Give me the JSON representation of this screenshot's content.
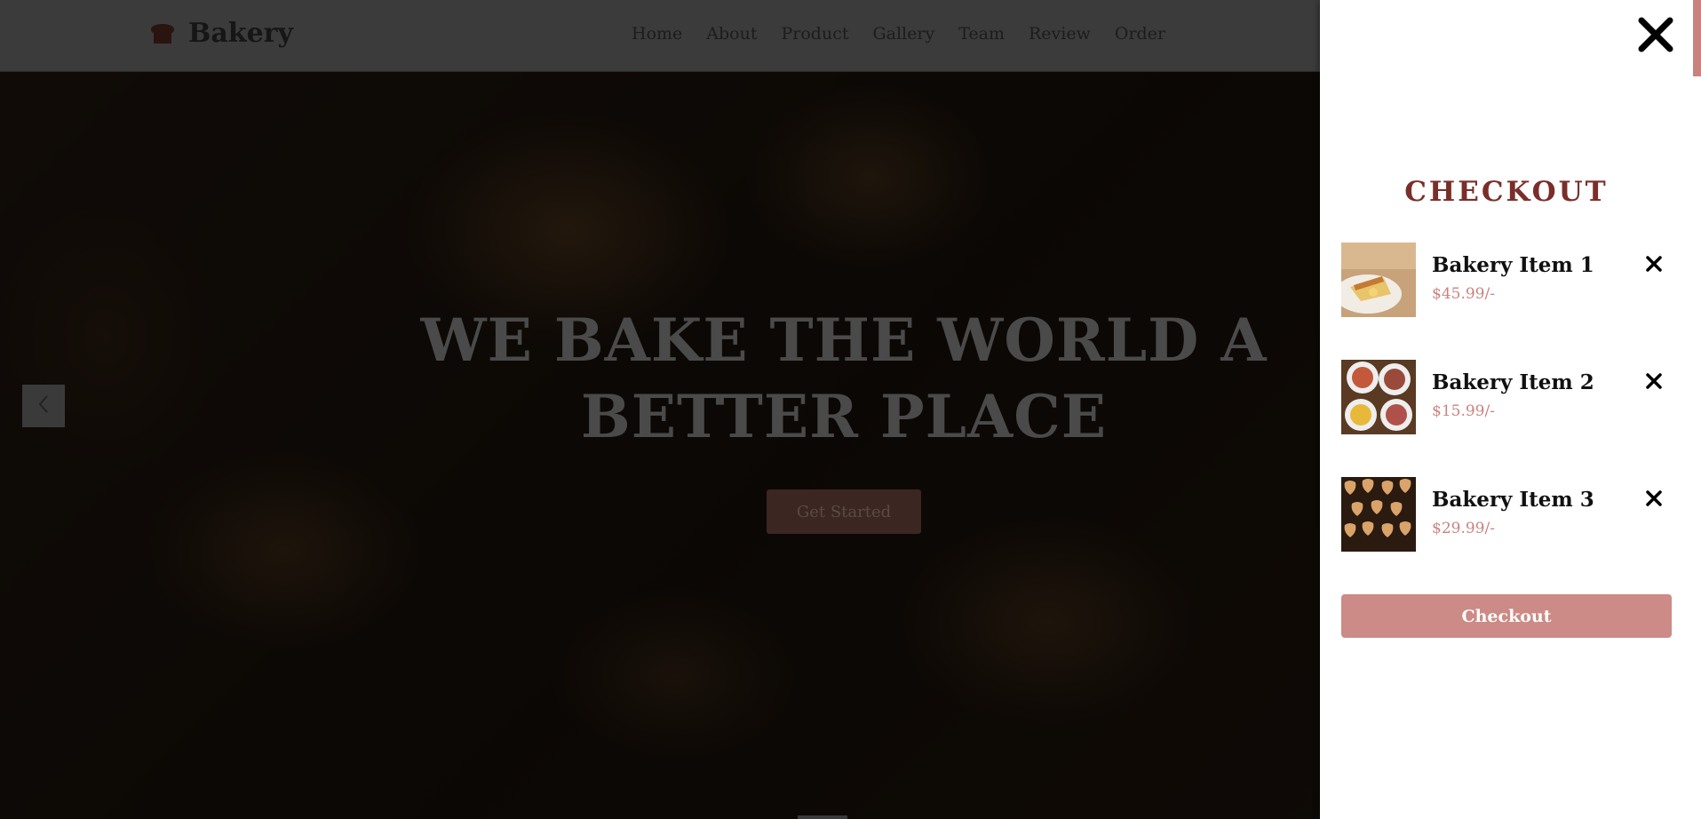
{
  "brand": {
    "name": "Bakery",
    "logo_icon": "bread-icon"
  },
  "nav": {
    "links": [
      "Home",
      "About",
      "Product",
      "Gallery",
      "Team",
      "Review",
      "Order"
    ]
  },
  "hero": {
    "title": "WE BAKE THE WORLD A BETTER PLACE",
    "cta_label": "Get Started",
    "prev_icon": "chevron-left-icon"
  },
  "checkout": {
    "close_icon": "close-icon",
    "title": "CHECKOUT",
    "items": [
      {
        "name": "Bakery Item 1",
        "price": "$45.99/-",
        "remove_icon": "close-icon"
      },
      {
        "name": "Bakery Item 2",
        "price": "$15.99/-",
        "remove_icon": "close-icon"
      },
      {
        "name": "Bakery Item 3",
        "price": "$29.99/-",
        "remove_icon": "close-icon"
      }
    ],
    "button_label": "Checkout"
  },
  "colors": {
    "accent": "#c9837f",
    "title_color": "#7a2e2a",
    "navbar_bg": "#3b3b3b"
  }
}
